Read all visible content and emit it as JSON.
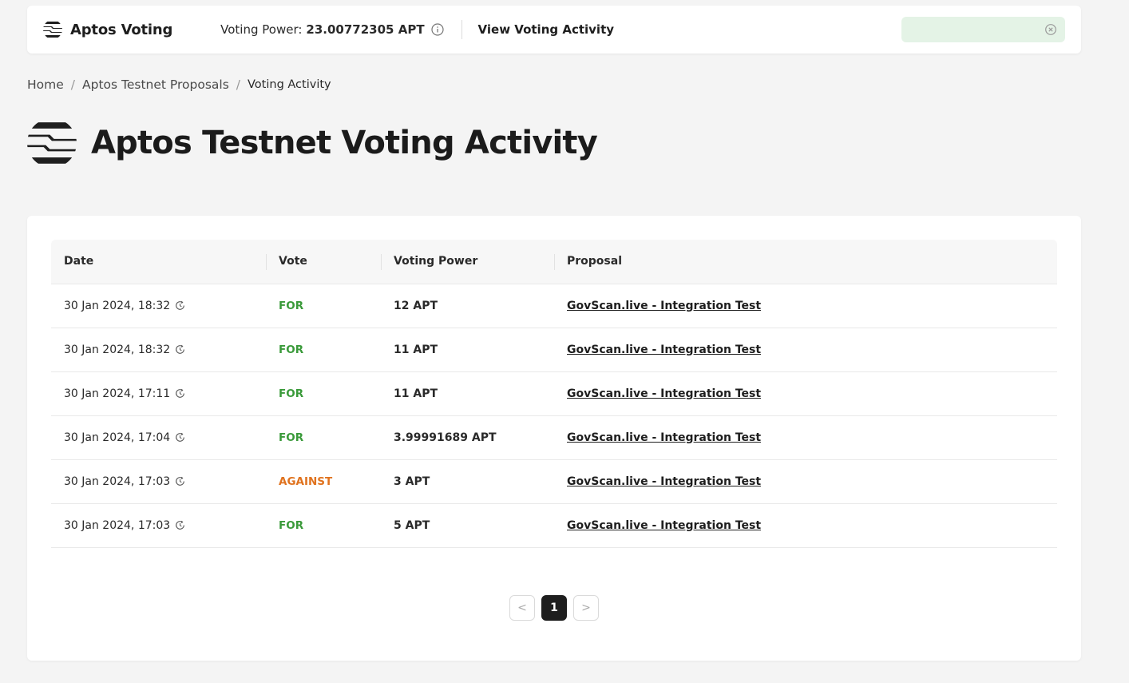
{
  "header": {
    "brand_name": "Aptos Voting",
    "voting_power_label": "Voting Power:",
    "voting_power_value": "23.00772305 APT",
    "view_activity_link": "View Voting Activity"
  },
  "breadcrumb": {
    "home": "Home",
    "proposals": "Aptos Testnet Proposals",
    "current": "Voting Activity",
    "separator": "/"
  },
  "page": {
    "title": "Aptos Testnet Voting Activity"
  },
  "table": {
    "columns": [
      "Date",
      "Vote",
      "Voting Power",
      "Proposal"
    ],
    "rows": [
      {
        "date": "30 Jan 2024, 18:32",
        "vote": "FOR",
        "power": "12 APT",
        "proposal": "GovScan.live - Integration Test"
      },
      {
        "date": "30 Jan 2024, 18:32",
        "vote": "FOR",
        "power": "11 APT",
        "proposal": "GovScan.live - Integration Test"
      },
      {
        "date": "30 Jan 2024, 17:11",
        "vote": "FOR",
        "power": "11 APT",
        "proposal": "GovScan.live - Integration Test"
      },
      {
        "date": "30 Jan 2024, 17:04",
        "vote": "FOR",
        "power": "3.99991689 APT",
        "proposal": "GovScan.live - Integration Test"
      },
      {
        "date": "30 Jan 2024, 17:03",
        "vote": "AGAINST",
        "power": "3 APT",
        "proposal": "GovScan.live - Integration Test"
      },
      {
        "date": "30 Jan 2024, 17:03",
        "vote": "FOR",
        "power": "5 APT",
        "proposal": "GovScan.live - Integration Test"
      }
    ]
  },
  "pagination": {
    "prev": "<",
    "current_page": "1",
    "next": ">"
  },
  "colors": {
    "for": "#3a9a3a",
    "against": "#e0731f",
    "wallet_pill_bg": "#e4f3e6"
  },
  "icons": {
    "brand": "aptos-logo-icon",
    "info": "info-icon",
    "close": "close-circle-icon",
    "clock": "clock-icon"
  }
}
